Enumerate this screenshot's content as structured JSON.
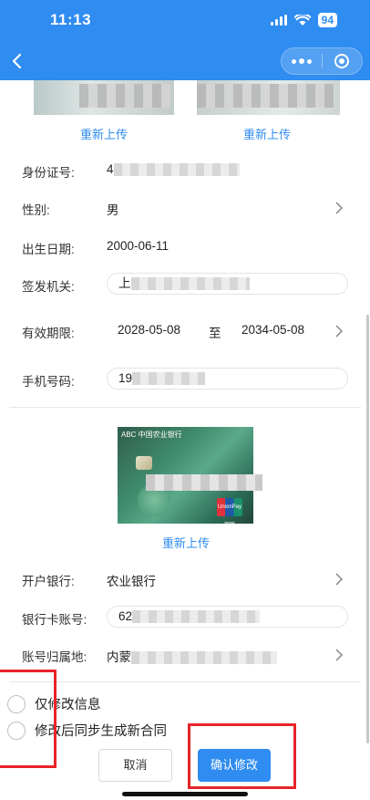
{
  "status_bar": {
    "time": "11:13",
    "battery": "94"
  },
  "id_section": {
    "reupload_left": "重新上传",
    "reupload_right": "重新上传",
    "id_number_label": "身份证号:",
    "id_number_value": "4",
    "gender_label": "性别:",
    "gender_value": "男",
    "birth_label": "出生日期:",
    "birth_value": "2000-06-11",
    "authority_label": "签发机关:",
    "authority_value": "上",
    "validity_label": "有效期限:",
    "validity_start": "2028-05-08",
    "validity_to": "至",
    "validity_end": "2034-05-08",
    "phone_label": "手机号码:",
    "phone_value": "19"
  },
  "bank_section": {
    "card_header": "ABC 中国农业银行",
    "unionpay": "UnionPay 银联",
    "reupload": "重新上传",
    "bank_label": "开户银行:",
    "bank_value": "农业银行",
    "account_label": "银行卡账号:",
    "account_value": "62",
    "location_label": "账号归属地:",
    "location_value": "内蒙"
  },
  "options": [
    {
      "label": "仅修改信息"
    },
    {
      "label": "修改后同步生成新合同"
    }
  ],
  "actions": {
    "cancel": "取消",
    "confirm": "确认修改"
  },
  "colors": {
    "header": "#2f8cf0",
    "link": "#2f8cf0",
    "highlight_box": "#e8242a"
  }
}
